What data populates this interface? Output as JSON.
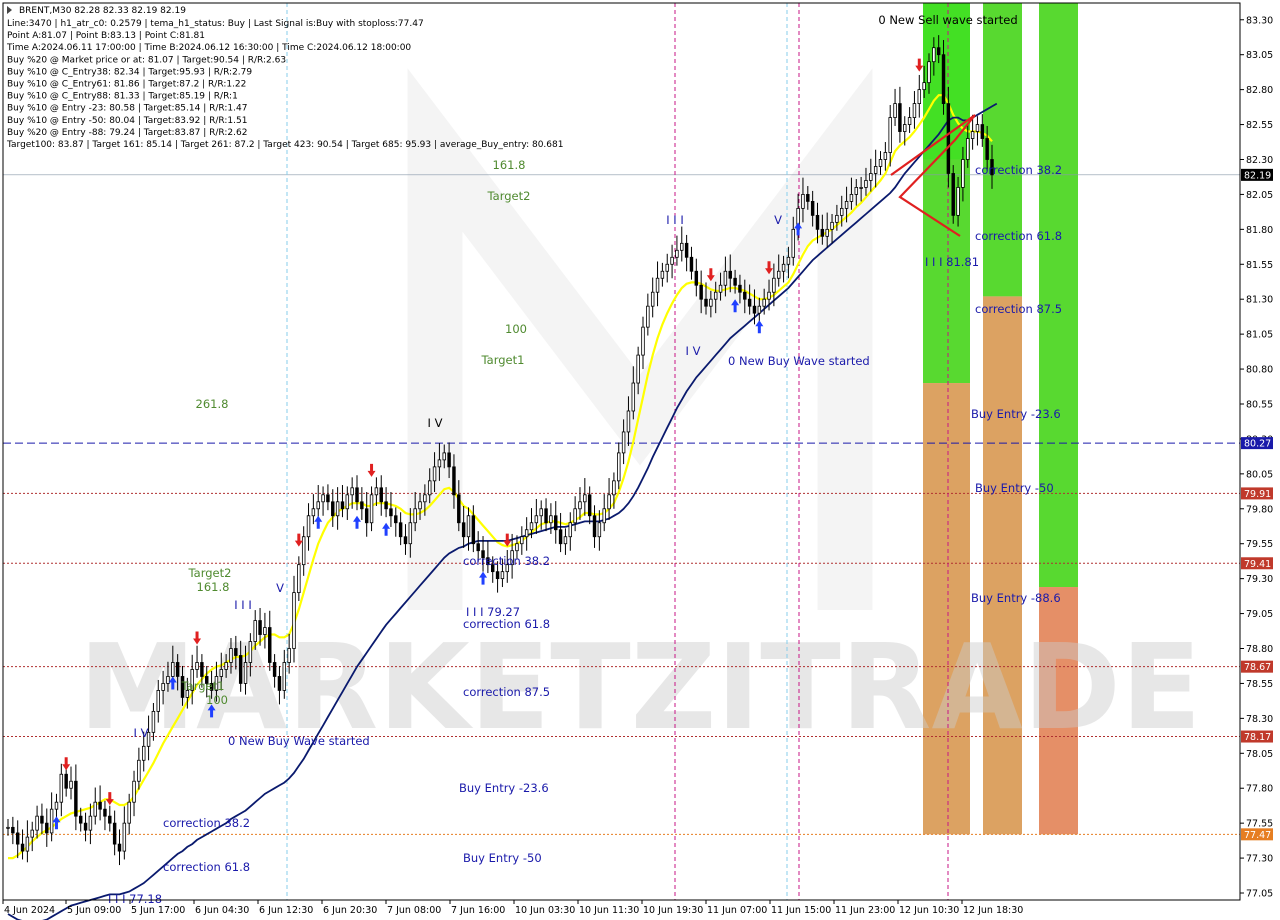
{
  "chart_data": {
    "type": "candlestick",
    "symbol": "BRENT,M30",
    "ohlc_header": "BRENT,M30  82.28 82.33 82.19 82.19",
    "info_lines": [
      "Line:3470 | h1_atr_c0: 0.2579 | tema_h1_status: Buy | Last Signal is:Buy with stoploss:77.47",
      "Point A:81.07 | Point B:83.13 | Point C:81.81",
      "Time A:2024.06.11 17:00:00 | Time B:2024.06.12 16:30:00 | Time C:2024.06.12 18:00:00",
      "Buy %20 @ Market price or at: 81.07 | Target:90.54 | R/R:2.63",
      "Buy %10 @ C_Entry38: 82.34 | Target:95.93 | R/R:2.79",
      "Buy %10 @ C_Entry61: 81.86 | Target:87.2 | R/R:1.22",
      "Buy %10 @ C_Entry88: 81.33 | Target:85.19 | R/R:1",
      "Buy %10 @ Entry -23: 80.58 | Target:85.14 | R/R:1.47",
      "Buy %10 @ Entry -50: 80.04 | Target:83.92 | R/R:1.51",
      "Buy %20 @ Entry -88: 79.24 | Target:83.87 | R/R:2.62",
      "Target100: 83.87 | Target 161: 85.14 | Target 261: 87.2 | Target 423: 90.54 | Target 685: 95.93 | average_Buy_entry: 80.681"
    ],
    "ylim": [
      77.0,
      83.42
    ],
    "y_ticks": [
      "83.30",
      "83.05",
      "82.80",
      "82.55",
      "82.30",
      "82.05",
      "81.80",
      "81.55",
      "81.30",
      "81.05",
      "80.80",
      "80.55",
      "80.30",
      "80.05",
      "79.80",
      "79.55",
      "79.30",
      "79.05",
      "78.80",
      "78.55",
      "78.30",
      "78.05",
      "77.80",
      "77.55",
      "77.30",
      "77.05"
    ],
    "x_ticks": [
      "4 Jun 2024",
      "5 Jun 09:00",
      "5 Jun 17:00",
      "6 Jun 04:30",
      "6 Jun 12:30",
      "6 Jun 20:30",
      "7 Jun 08:00",
      "7 Jun 16:00",
      "10 Jun 03:30",
      "10 Jun 11:30",
      "10 Jun 19:30",
      "11 Jun 07:00",
      "11 Jun 15:00",
      "11 Jun 23:00",
      "12 Jun 10:30",
      "12 Jun 18:30"
    ],
    "current_price": 82.19,
    "price_labels": [
      {
        "text": "82.19",
        "value": 82.19,
        "color": "#000000"
      },
      {
        "text": "80.27",
        "value": 80.27,
        "color": "#1a1aaa"
      },
      {
        "text": "79.91",
        "value": 79.91,
        "color": "#c0392b"
      },
      {
        "text": "79.41",
        "value": 79.41,
        "color": "#c0392b"
      },
      {
        "text": "78.67",
        "value": 78.67,
        "color": "#c0392b"
      },
      {
        "text": "78.17",
        "value": 78.17,
        "color": "#c0392b"
      },
      {
        "text": "77.47",
        "value": 77.47,
        "color": "#e67e22"
      }
    ],
    "h_lines": [
      {
        "value": 80.27,
        "color": "#1a1aaa",
        "style": "dashed"
      },
      {
        "value": 79.91,
        "color": "#b03030",
        "style": "dotted"
      },
      {
        "value": 79.41,
        "color": "#b03030",
        "style": "dotted"
      },
      {
        "value": 78.67,
        "color": "#b03030",
        "style": "dotted"
      },
      {
        "value": 78.17,
        "color": "#b03030",
        "style": "dotted"
      },
      {
        "value": 77.47,
        "color": "#e67e22",
        "style": "dotted"
      },
      {
        "value": 82.19,
        "color": "#8899aa",
        "style": "solid"
      }
    ],
    "series": [
      {
        "name": "close",
        "values": [
          77.52,
          77.48,
          77.4,
          77.35,
          77.45,
          77.5,
          77.6,
          77.55,
          77.48,
          77.65,
          77.7,
          77.9,
          77.8,
          77.85,
          77.6,
          77.55,
          77.5,
          77.6,
          77.7,
          77.65,
          77.6,
          77.55,
          77.4,
          77.35,
          77.55,
          77.7,
          77.85,
          78.0,
          78.1,
          78.2,
          78.35,
          78.5,
          78.55,
          78.6,
          78.7,
          78.6,
          78.45,
          78.5,
          78.65,
          78.7,
          78.6,
          78.55,
          78.5,
          78.6,
          78.65,
          78.7,
          78.8,
          78.75,
          78.55,
          78.7,
          78.85,
          79.0,
          78.9,
          78.95,
          78.7,
          78.6,
          78.5,
          78.7,
          78.8,
          79.2,
          79.4,
          79.6,
          79.75,
          79.8,
          79.85,
          79.9,
          79.85,
          79.75,
          79.85,
          79.8,
          79.9,
          79.95,
          79.85,
          79.8,
          79.7,
          79.9,
          79.95,
          79.85,
          79.8,
          79.75,
          79.7,
          79.6,
          79.55,
          79.7,
          79.8,
          79.85,
          79.9,
          80.0,
          80.1,
          80.15,
          80.2,
          80.1,
          79.9,
          79.7,
          79.6,
          79.75,
          79.55,
          79.5,
          79.45,
          79.4,
          79.35,
          79.3,
          79.35,
          79.4,
          79.5,
          79.55,
          79.6,
          79.65,
          79.7,
          79.75,
          79.8,
          79.7,
          79.75,
          79.65,
          79.55,
          79.6,
          79.7,
          79.8,
          79.85,
          79.9,
          79.75,
          79.6,
          79.7,
          79.8,
          79.9,
          80.0,
          80.2,
          80.35,
          80.5,
          80.7,
          80.9,
          81.1,
          81.25,
          81.35,
          81.45,
          81.5,
          81.55,
          81.6,
          81.65,
          81.7,
          81.6,
          81.5,
          81.4,
          81.3,
          81.25,
          81.3,
          81.35,
          81.4,
          81.5,
          81.45,
          81.4,
          81.35,
          81.3,
          81.25,
          81.2,
          81.25,
          81.3,
          81.35,
          81.45,
          81.5,
          81.55,
          81.6,
          81.8,
          81.95,
          82.05,
          82.0,
          81.9,
          81.8,
          81.75,
          81.8,
          81.85,
          81.9,
          81.95,
          82.0,
          82.05,
          82.1,
          82.1,
          82.15,
          82.2,
          82.25,
          82.3,
          82.35,
          82.6,
          82.7,
          82.5,
          82.55,
          82.6,
          82.7,
          82.8,
          82.85,
          83.0,
          83.1,
          83.05,
          82.7,
          82.2,
          81.9,
          82.1,
          82.3,
          82.45,
          82.5,
          82.55,
          82.45,
          82.3,
          82.19
        ]
      }
    ],
    "moving_averages": [
      {
        "name": "yellow",
        "color": "#ffff00",
        "values": [
          77.3,
          77.3,
          77.32,
          77.35,
          77.38,
          77.42,
          77.45,
          77.48,
          77.5,
          77.52,
          77.55,
          77.58,
          77.6,
          77.62,
          77.63,
          77.64,
          77.65,
          77.66,
          77.68,
          77.7,
          77.72,
          77.72,
          77.7,
          77.68,
          77.68,
          77.7,
          77.74,
          77.8,
          77.86,
          77.92,
          77.98,
          78.05,
          78.12,
          78.18,
          78.24,
          78.3,
          78.36,
          78.42,
          78.48,
          78.54,
          78.58,
          78.62,
          78.65,
          78.67,
          78.68,
          78.7,
          78.72,
          78.74,
          78.74,
          78.75,
          78.78,
          78.82,
          78.85,
          78.88,
          78.9,
          78.9,
          78.88,
          78.88,
          78.9,
          78.98,
          79.08,
          79.2,
          79.32,
          79.44,
          79.55,
          79.63,
          79.7,
          79.74,
          79.78,
          79.8,
          79.82,
          79.84,
          79.84,
          79.84,
          79.82,
          79.82,
          79.84,
          79.84,
          79.84,
          79.83,
          79.82,
          79.8,
          79.77,
          79.76,
          79.76,
          79.77,
          79.79,
          79.82,
          79.86,
          79.9,
          79.94,
          79.95,
          79.92,
          79.87,
          79.82,
          79.8,
          79.76,
          79.72,
          79.68,
          79.64,
          79.6,
          79.56,
          79.54,
          79.53,
          79.54,
          79.55,
          79.57,
          79.6,
          79.63,
          79.66,
          79.69,
          79.7,
          79.71,
          79.71,
          79.7,
          79.69,
          79.7,
          79.72,
          79.74,
          79.77,
          79.77,
          79.76,
          79.76,
          79.77,
          79.8,
          79.84,
          79.92,
          80.02,
          80.14,
          80.28,
          80.44,
          80.6,
          80.76,
          80.9,
          81.02,
          81.12,
          81.2,
          81.27,
          81.33,
          81.38,
          81.41,
          81.42,
          81.42,
          81.41,
          81.39,
          81.37,
          81.36,
          81.36,
          81.37,
          81.38,
          81.38,
          81.37,
          81.36,
          81.34,
          81.32,
          81.3,
          81.3,
          81.31,
          81.33,
          81.36,
          81.39,
          81.42,
          81.48,
          81.55,
          81.62,
          81.68,
          81.72,
          81.74,
          81.76,
          81.78,
          81.8,
          81.83,
          81.86,
          81.89,
          81.92,
          81.96,
          81.99,
          82.03,
          82.07,
          82.11,
          82.15,
          82.2,
          82.28,
          82.36,
          82.4,
          82.43,
          82.46,
          82.5,
          82.55,
          82.6,
          82.66,
          82.72,
          82.76,
          82.76,
          82.7,
          82.62,
          82.56,
          82.52,
          82.5,
          82.5,
          82.5,
          82.49,
          82.47,
          82.43
        ]
      },
      {
        "name": "navy",
        "color": "#0a1a6e",
        "values": [
          76.9,
          76.88,
          76.86,
          76.85,
          76.84,
          76.84,
          76.84,
          76.85,
          76.86,
          76.88,
          76.9,
          76.92,
          76.94,
          76.96,
          76.97,
          76.98,
          76.99,
          77.0,
          77.01,
          77.02,
          77.03,
          77.04,
          77.04,
          77.04,
          77.05,
          77.06,
          77.08,
          77.1,
          77.12,
          77.15,
          77.18,
          77.21,
          77.24,
          77.27,
          77.3,
          77.33,
          77.35,
          77.38,
          77.4,
          77.43,
          77.45,
          77.47,
          77.49,
          77.51,
          77.53,
          77.55,
          77.58,
          77.6,
          77.62,
          77.64,
          77.67,
          77.7,
          77.73,
          77.76,
          77.78,
          77.8,
          77.82,
          77.84,
          77.87,
          77.91,
          77.96,
          78.01,
          78.07,
          78.13,
          78.19,
          78.25,
          78.31,
          78.37,
          78.43,
          78.49,
          78.55,
          78.61,
          78.67,
          78.72,
          78.77,
          78.82,
          78.87,
          78.92,
          78.97,
          79.01,
          79.05,
          79.09,
          79.13,
          79.17,
          79.21,
          79.25,
          79.29,
          79.33,
          79.37,
          79.41,
          79.45,
          79.48,
          79.5,
          79.52,
          79.53,
          79.55,
          79.56,
          79.57,
          79.57,
          79.57,
          79.57,
          79.57,
          79.57,
          79.57,
          79.58,
          79.59,
          79.6,
          79.61,
          79.62,
          79.63,
          79.64,
          79.65,
          79.66,
          79.67,
          79.67,
          79.67,
          79.68,
          79.69,
          79.7,
          79.71,
          79.71,
          79.71,
          79.71,
          79.72,
          79.73,
          79.75,
          79.77,
          79.8,
          79.84,
          79.89,
          79.95,
          80.02,
          80.09,
          80.17,
          80.24,
          80.31,
          80.38,
          80.45,
          80.52,
          80.58,
          80.64,
          80.69,
          80.74,
          80.78,
          80.82,
          80.86,
          80.9,
          80.94,
          80.98,
          81.02,
          81.05,
          81.08,
          81.11,
          81.14,
          81.17,
          81.2,
          81.23,
          81.26,
          81.29,
          81.32,
          81.35,
          81.38,
          81.42,
          81.46,
          81.5,
          81.54,
          81.58,
          81.61,
          81.64,
          81.67,
          81.7,
          81.73,
          81.76,
          81.79,
          81.82,
          81.85,
          81.88,
          81.91,
          81.94,
          81.97,
          82.0,
          82.03,
          82.06,
          82.1,
          82.15,
          82.2,
          82.24,
          82.28,
          82.32,
          82.36,
          82.4,
          82.44,
          82.48,
          82.53,
          82.58,
          82.6,
          82.6,
          82.58,
          82.58,
          82.6,
          82.62,
          82.64,
          82.66,
          82.68,
          82.7
        ]
      }
    ],
    "vertical_lines": [
      {
        "pos": "7 Jun 16:00",
        "color": "#87ceeb"
      },
      {
        "pos": "10 Jun 19:30",
        "color": "#c71585"
      },
      {
        "pos": "11 Jun 15:00 a",
        "color": "#c71585"
      },
      {
        "pos": "11 Jun 15:00 b",
        "color": "#87ceeb"
      },
      {
        "pos": "12 Jun 10:30",
        "color": "#c71585"
      }
    ],
    "zones": [
      {
        "col": "a",
        "from": 82.3,
        "to": 83.42,
        "color": "#33dd11"
      },
      {
        "col": "a",
        "from": 80.7,
        "to": 82.3,
        "color": "#4ad61e"
      },
      {
        "col": "a",
        "from": 77.47,
        "to": 80.7,
        "color": "#d99a55"
      },
      {
        "col": "b",
        "from": 81.32,
        "to": 83.42,
        "color": "#4ad61e"
      },
      {
        "col": "b",
        "from": 77.47,
        "to": 81.32,
        "color": "#d99a55"
      },
      {
        "col": "c",
        "from": 79.24,
        "to": 83.42,
        "color": "#4ad61e"
      },
      {
        "col": "c",
        "from": 77.47,
        "to": 79.24,
        "color": "#e3855a"
      }
    ],
    "annotations": [
      {
        "text": "0 New Sell wave started",
        "color": "#000000",
        "anchor": "top-right-zone-label"
      },
      {
        "text": "correction 38.2",
        "color": "#1a1aaa"
      },
      {
        "text": "correction 61.8",
        "color": "#1a1aaa"
      },
      {
        "text": "correction 87.5",
        "color": "#1a1aaa"
      },
      {
        "text": "Buy Entry -23.6",
        "color": "#1a1aaa"
      },
      {
        "text": "Buy Entry -50",
        "color": "#1a1aaa"
      },
      {
        "text": "Buy Entry -88.6",
        "color": "#1a1aaa"
      },
      {
        "text": "I I I 81.81",
        "color": "#1a1aaa"
      },
      {
        "text": "I I I",
        "color": "#1a1aaa"
      },
      {
        "text": "V",
        "color": "#1a1aaa"
      },
      {
        "text": "I V",
        "color": "#1a1aaa"
      },
      {
        "text": "0 New Buy Wave started",
        "color": "#1a1aaa"
      },
      {
        "text": "161.8",
        "color": "#4f8a2f"
      },
      {
        "text": "Target2",
        "color": "#4f8a2f"
      },
      {
        "text": "100",
        "color": "#4f8a2f"
      },
      {
        "text": "Target1",
        "color": "#4f8a2f"
      },
      {
        "text": "261.8",
        "color": "#4f8a2f"
      },
      {
        "text": "I V",
        "color": "#000000"
      },
      {
        "text": "correction 38.2",
        "color": "#1a1aaa"
      },
      {
        "text": "I I I 79.27",
        "color": "#1a1aaa"
      },
      {
        "text": "correction 61.8",
        "color": "#1a1aaa"
      },
      {
        "text": "correction 87.5",
        "color": "#1a1aaa"
      },
      {
        "text": "Buy Entry -23.6",
        "color": "#1a1aaa"
      },
      {
        "text": "Buy Entry -50",
        "color": "#1a1aaa"
      },
      {
        "text": "Target2",
        "color": "#4f8a2f"
      },
      {
        "text": "161.8",
        "color": "#4f8a2f"
      },
      {
        "text": "I I I",
        "color": "#1a1aaa"
      },
      {
        "text": "V",
        "color": "#1a1aaa"
      },
      {
        "text": "Target1",
        "color": "#4f8a2f"
      },
      {
        "text": "100",
        "color": "#4f8a2f"
      },
      {
        "text": "0 New Buy Wave started",
        "color": "#1a1aaa"
      },
      {
        "text": "correction 38.2",
        "color": "#1a1aaa"
      },
      {
        "text": "correction 61.8",
        "color": "#1a1aaa"
      },
      {
        "text": "I I I 77.18",
        "color": "#1a1aaa"
      },
      {
        "text": "I V",
        "color": "#1a1aaa"
      }
    ],
    "watermark": "MARKETZITRADE",
    "grid": false
  }
}
